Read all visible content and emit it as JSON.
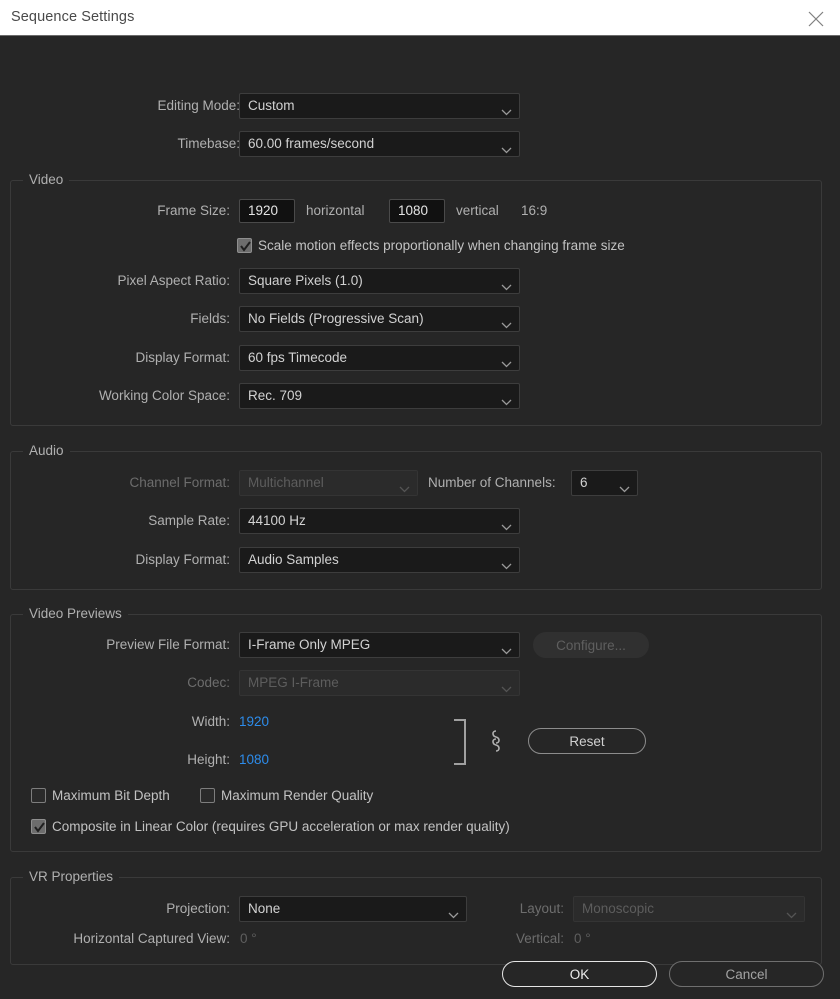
{
  "window": {
    "title": "Sequence Settings",
    "close_icon": "close-icon"
  },
  "top": {
    "editing_mode_label": "Editing Mode:",
    "editing_mode_value": "Custom",
    "timebase_label": "Timebase:",
    "timebase_value": "60.00  frames/second"
  },
  "video": {
    "legend": "Video",
    "frame_size_label": "Frame Size:",
    "frame_width_value": "1920",
    "horizontal_label": "horizontal",
    "frame_height_value": "1080",
    "vertical_label": "vertical",
    "aspect_ratio_text": "16:9",
    "scale_motion_label": "Scale motion effects proportionally when changing frame size",
    "scale_motion_checked": true,
    "pixel_aspect_label": "Pixel Aspect Ratio:",
    "pixel_aspect_value": "Square Pixels (1.0)",
    "fields_label": "Fields:",
    "fields_value": "No Fields (Progressive Scan)",
    "display_format_label": "Display Format:",
    "display_format_value": "60 fps Timecode",
    "working_color_space_label": "Working Color Space:",
    "working_color_space_value": "Rec. 709"
  },
  "audio": {
    "legend": "Audio",
    "channel_format_label": "Channel Format:",
    "channel_format_value": "Multichannel",
    "number_of_channels_label": "Number of Channels:",
    "number_of_channels_value": "6",
    "sample_rate_label": "Sample Rate:",
    "sample_rate_value": "44100 Hz",
    "display_format_label": "Display Format:",
    "display_format_value": "Audio Samples"
  },
  "video_previews": {
    "legend": "Video Previews",
    "preview_file_format_label": "Preview File Format:",
    "preview_file_format_value": "I-Frame Only MPEG",
    "configure_label": "Configure...",
    "codec_label": "Codec:",
    "codec_value": "MPEG I-Frame",
    "width_label": "Width:",
    "width_value": "1920",
    "height_label": "Height:",
    "height_value": "1080",
    "reset_label": "Reset",
    "link_icon": "chain-link-icon",
    "max_bit_depth_label": "Maximum Bit Depth",
    "max_bit_depth_checked": false,
    "max_render_quality_label": "Maximum Render Quality",
    "max_render_quality_checked": false,
    "composite_linear_label": "Composite in Linear Color (requires GPU acceleration or max render quality)",
    "composite_linear_checked": true
  },
  "vr": {
    "legend": "VR Properties",
    "projection_label": "Projection:",
    "projection_value": "None",
    "layout_label": "Layout:",
    "layout_value": "Monoscopic",
    "horizontal_captured_label": "Horizontal Captured View:",
    "horizontal_captured_value": "0 °",
    "vertical_label": "Vertical:",
    "vertical_value": "0 °"
  },
  "footer": {
    "ok_label": "OK",
    "cancel_label": "Cancel"
  },
  "colors": {
    "accent_link": "#2d8ceb",
    "background": "#262626",
    "titlebar": "#ffffff"
  }
}
